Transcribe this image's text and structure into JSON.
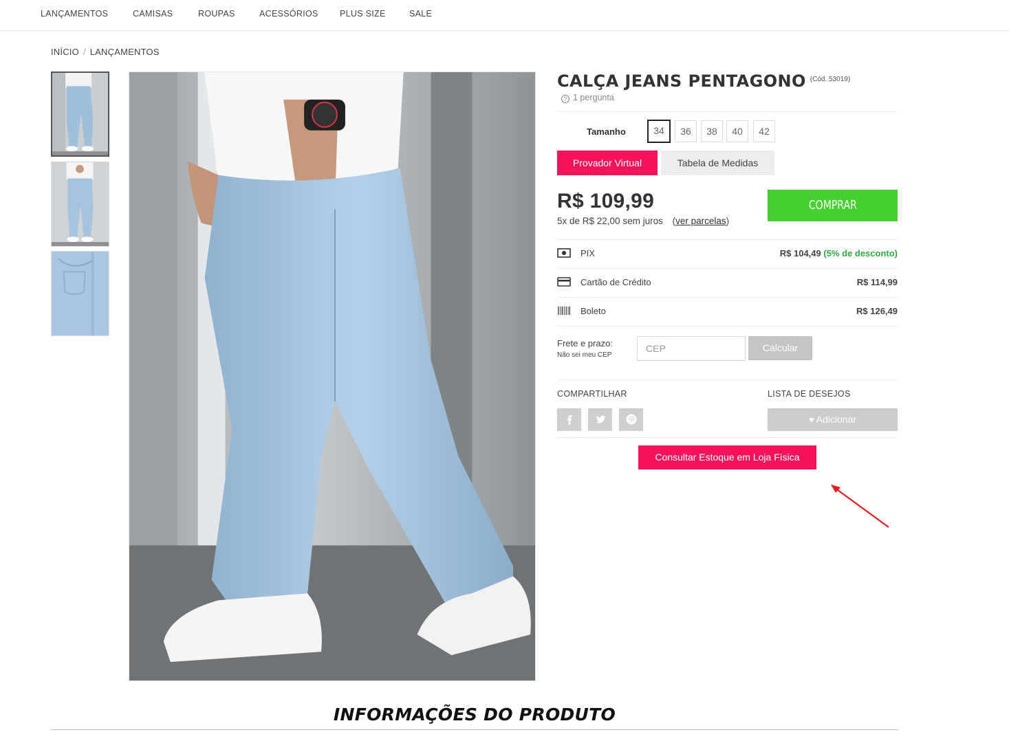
{
  "nav": {
    "items": [
      "LANÇAMENTOS",
      "CAMISAS",
      "ROUPAS",
      "ACESSÓRIOS",
      "PLUS SIZE",
      "SALE"
    ]
  },
  "breadcrumb": {
    "home": "INÍCIO",
    "separator": "/",
    "current": "LANÇAMENTOS"
  },
  "product": {
    "title": "CALÇA JEANS PENTAGONO",
    "code": "(Cód. 53019)",
    "questions": "1 pergunta",
    "size_label": "Tamanho",
    "sizes": [
      "34",
      "36",
      "38",
      "40",
      "42"
    ],
    "selected_size": "34",
    "btn_provador": "Provador Virtual",
    "btn_tabela": "Tabela de Medidas",
    "price": "R$ 109,99",
    "installments": "5x de R$ 22,00 sem juros",
    "installments_link_open": "(",
    "installments_link": "ver parcelas",
    "installments_link_close": ")",
    "btn_buy": "COMPRAR",
    "payments": [
      {
        "name": "PIX",
        "value": "R$ 104,49",
        "discount": "(5% de desconto)"
      },
      {
        "name": "Cartão de Crédito",
        "value": "R$ 114,99"
      },
      {
        "name": "Boleto",
        "value": "R$ 126,49"
      }
    ],
    "shipping": {
      "label": "Frete e prazo:",
      "no_cep": "Não sei meu CEP",
      "placeholder": "CEP",
      "btn": "Calcular"
    },
    "share_label": "COMPARTILHAR",
    "share_icons": [
      "facebook-icon",
      "twitter-icon",
      "pinterest-icon"
    ],
    "wishlist_label": "LISTA DE DESEJOS",
    "wishlist_btn": "Adicionar",
    "btn_stock": "Consultar Estoque em Loja Física"
  },
  "info_title": "INFORMAÇÕES DO PRODUTO",
  "colors": {
    "accent_pink": "#f7135a",
    "buy_green": "#45d130",
    "discount_green": "#2eaa44",
    "annotation_arrow": "#e51c1c"
  }
}
